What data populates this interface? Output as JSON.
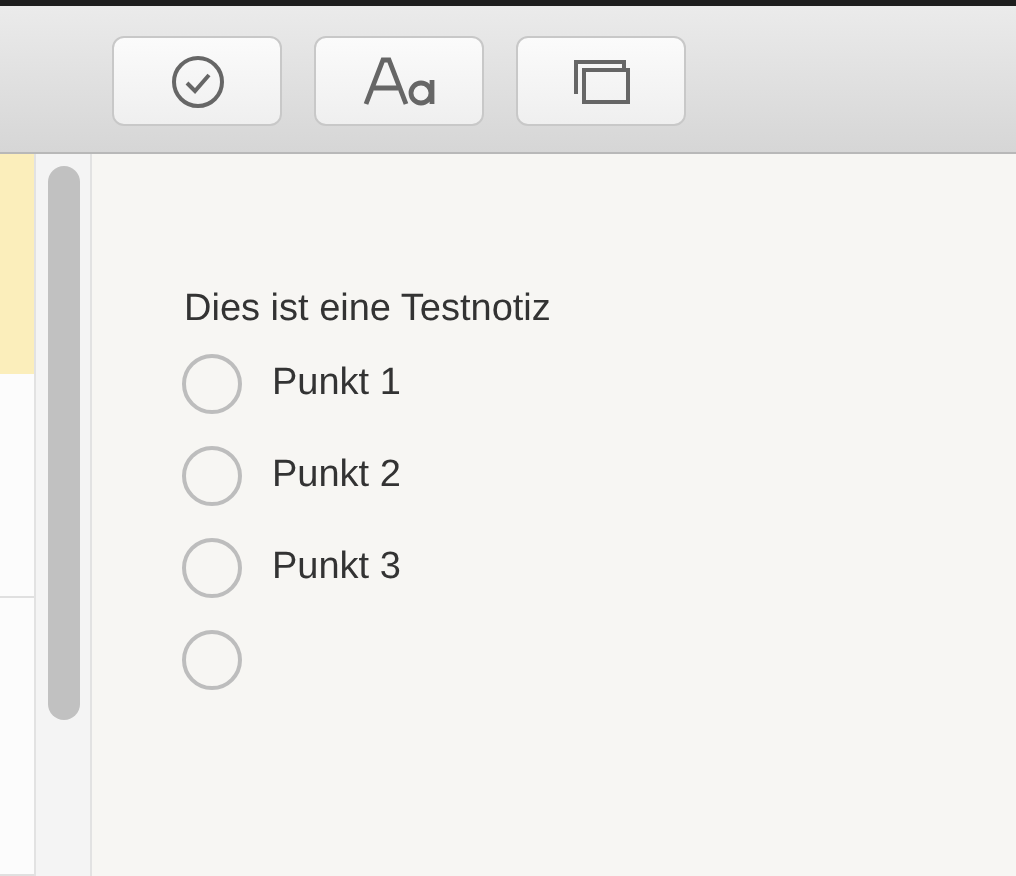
{
  "toolbar": {
    "buttons": [
      {
        "kind": "checklist"
      },
      {
        "kind": "format"
      },
      {
        "kind": "gallery"
      }
    ]
  },
  "note_list": [
    {
      "selected": true
    },
    {
      "selected": false
    },
    {
      "selected": false
    }
  ],
  "note": {
    "title": "Dies ist eine Testnotiz",
    "checklist": [
      {
        "text": "Punkt 1",
        "checked": false
      },
      {
        "text": "Punkt 2",
        "checked": false
      },
      {
        "text": "Punkt 3",
        "checked": false
      },
      {
        "checked": false
      }
    ]
  }
}
